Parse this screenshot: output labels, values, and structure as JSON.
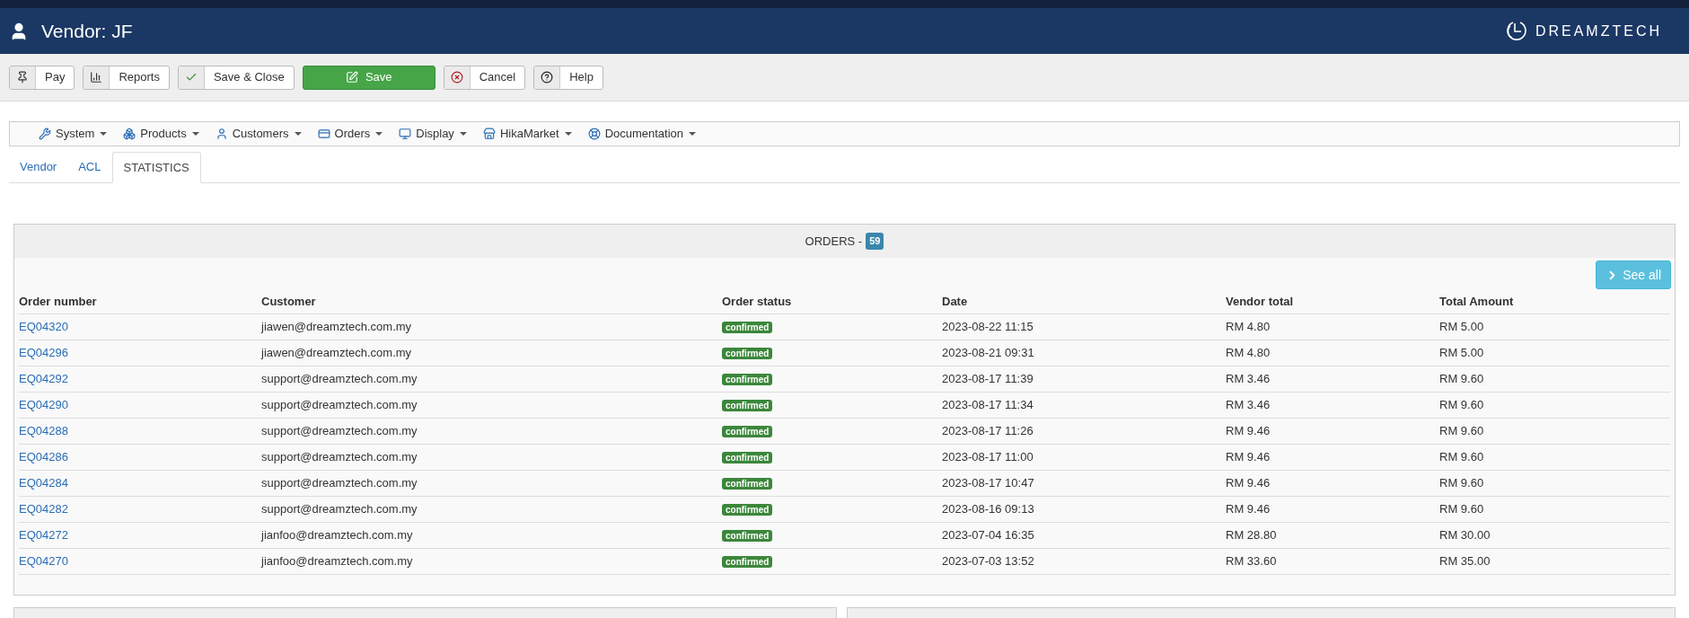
{
  "header": {
    "title": "Vendor: JF",
    "logo": "DREAMZTECH"
  },
  "toolbar": [
    {
      "label": "Pay",
      "kind": "default"
    },
    {
      "label": "Reports",
      "kind": "default"
    },
    {
      "label": "Save & Close",
      "kind": "default"
    },
    {
      "label": "Save",
      "kind": "primary"
    },
    {
      "label": "Cancel",
      "kind": "default"
    },
    {
      "label": "Help",
      "kind": "default"
    }
  ],
  "menu": [
    {
      "label": "System"
    },
    {
      "label": "Products"
    },
    {
      "label": "Customers"
    },
    {
      "label": "Orders"
    },
    {
      "label": "Display"
    },
    {
      "label": "HikaMarket"
    },
    {
      "label": "Documentation"
    }
  ],
  "tabs": [
    {
      "label": "Vendor",
      "selected": false
    },
    {
      "label": "ACL",
      "selected": false
    },
    {
      "label": "STATISTICS",
      "selected": true
    }
  ],
  "orders_panel": {
    "title": "ORDERS -",
    "count": "59",
    "see_all": "See all",
    "columns": [
      "Order number",
      "Customer",
      "Order status",
      "Date",
      "Vendor total",
      "Total Amount"
    ],
    "rows": [
      {
        "order": "EQ04320",
        "customer": "jiawen@dreamztech.com.my",
        "status": "confirmed",
        "date": "2023-08-22 11:15",
        "vendor_total": "RM 4.80",
        "total": "RM 5.00"
      },
      {
        "order": "EQ04296",
        "customer": "jiawen@dreamztech.com.my",
        "status": "confirmed",
        "date": "2023-08-21 09:31",
        "vendor_total": "RM 4.80",
        "total": "RM 5.00"
      },
      {
        "order": "EQ04292",
        "customer": "support@dreamztech.com.my",
        "status": "confirmed",
        "date": "2023-08-17 11:39",
        "vendor_total": "RM 3.46",
        "total": "RM 9.60"
      },
      {
        "order": "EQ04290",
        "customer": "support@dreamztech.com.my",
        "status": "confirmed",
        "date": "2023-08-17 11:34",
        "vendor_total": "RM 3.46",
        "total": "RM 9.60"
      },
      {
        "order": "EQ04288",
        "customer": "support@dreamztech.com.my",
        "status": "confirmed",
        "date": "2023-08-17 11:26",
        "vendor_total": "RM 9.46",
        "total": "RM 9.60"
      },
      {
        "order": "EQ04286",
        "customer": "support@dreamztech.com.my",
        "status": "confirmed",
        "date": "2023-08-17 11:00",
        "vendor_total": "RM 9.46",
        "total": "RM 9.60"
      },
      {
        "order": "EQ04284",
        "customer": "support@dreamztech.com.my",
        "status": "confirmed",
        "date": "2023-08-17 10:47",
        "vendor_total": "RM 9.46",
        "total": "RM 9.60"
      },
      {
        "order": "EQ04282",
        "customer": "support@dreamztech.com.my",
        "status": "confirmed",
        "date": "2023-08-16 09:13",
        "vendor_total": "RM 9.46",
        "total": "RM 9.60"
      },
      {
        "order": "EQ04272",
        "customer": "jianfoo@dreamztech.com.my",
        "status": "confirmed",
        "date": "2023-07-04 16:35",
        "vendor_total": "RM 28.80",
        "total": "RM 30.00"
      },
      {
        "order": "EQ04270",
        "customer": "jianfoo@dreamztech.com.my",
        "status": "confirmed",
        "date": "2023-07-03 13:52",
        "vendor_total": "RM 33.60",
        "total": "RM 35.00"
      }
    ]
  }
}
